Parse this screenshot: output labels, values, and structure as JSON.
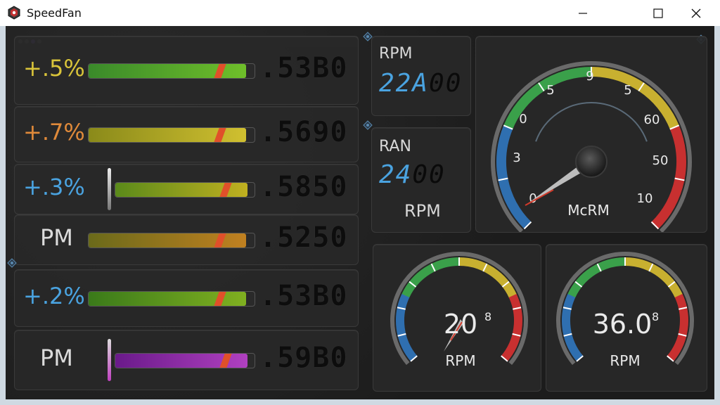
{
  "window": {
    "title": "SpeedFan",
    "minimize_icon": "minimize-icon",
    "maximize_icon": "maximize-icon",
    "close_icon": "close-icon"
  },
  "rows": [
    {
      "label": "+.5%",
      "label_color": "#d9c43a",
      "value": ".53B0",
      "bar_level": 0.95,
      "bar_colors": [
        "#3a8a2a",
        "#6fbf2a"
      ]
    },
    {
      "label": "+.7%",
      "label_color": "#e08a3a",
      "value": ".5690",
      "bar_level": 0.95,
      "bar_colors": [
        "#8a8a1a",
        "#d0c030"
      ]
    },
    {
      "label": "+.3%",
      "label_color": "#4aa3e0",
      "value": ".5850",
      "bar_level": 0.95,
      "bar_colors": [
        "#5a8a1a",
        "#c0b020"
      ]
    },
    {
      "label": "PM",
      "label_color": "#dcdcdc",
      "value": ".5250",
      "bar_level": 0.95,
      "bar_colors": [
        "#6a6a1a",
        "#c08020"
      ]
    },
    {
      "label": "+.2%",
      "label_color": "#4aa3e0",
      "value": ".53B0",
      "bar_level": 0.95,
      "bar_colors": [
        "#3a7a1a",
        "#80b020"
      ]
    },
    {
      "label": "PM",
      "label_color": "#dcdcdc",
      "value": ".59B0",
      "bar_level": 0.95,
      "bar_colors": [
        "#6a1a8a",
        "#b040c0"
      ]
    }
  ],
  "rpm_panel_1": {
    "label": "RPM",
    "digits_lit": "22A",
    "digits_dim": "00"
  },
  "rpm_panel_2": {
    "label": "RAN",
    "digits_lit": "24",
    "digits_dim": "00",
    "unit": "RPM"
  },
  "main_gauge": {
    "tick_labels": [
      "0",
      "3",
      "0",
      "5",
      "9",
      "5",
      "60",
      "50",
      "10"
    ],
    "unit": "McRM"
  },
  "small_gauge_1": {
    "value": "20",
    "superscript": "8",
    "unit": "RPM"
  },
  "small_gauge_2": {
    "value": "36.0",
    "superscript": "8",
    "unit": "RPM"
  },
  "colors": {
    "accent_blue": "#4aa3e0",
    "needle_red": "#d23a2a",
    "arc_blue": "#2f6fb0",
    "arc_green": "#3aa04a",
    "arc_yellow": "#c8b030",
    "arc_red": "#c83030"
  }
}
